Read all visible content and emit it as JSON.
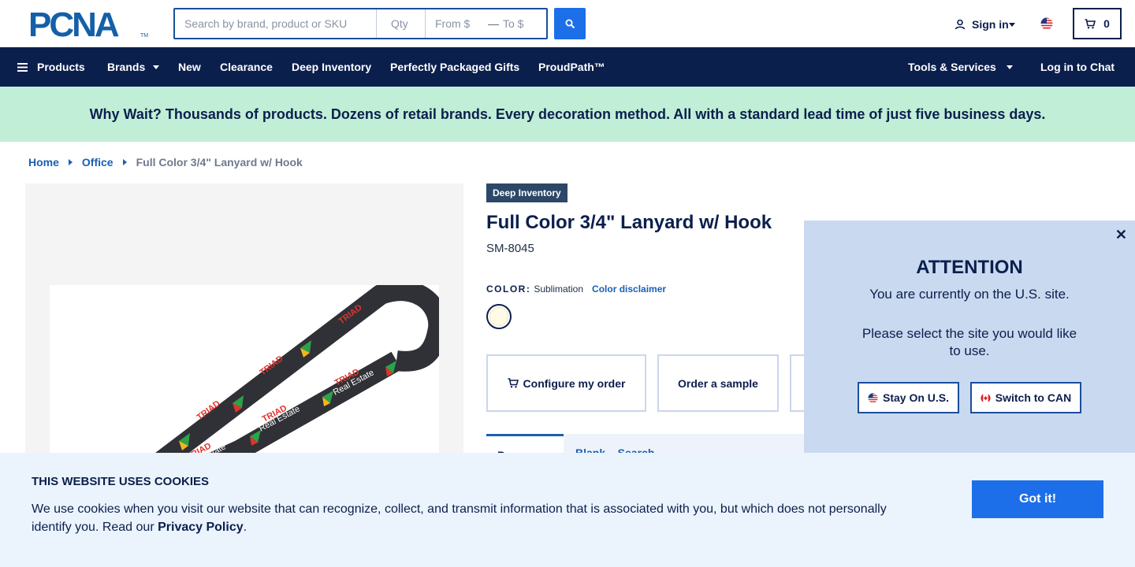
{
  "header": {
    "logo": "PCNA",
    "search_placeholder": "Search by brand, product or SKU",
    "qty_placeholder": "Qty",
    "from_placeholder": "From $",
    "price_dash": "—",
    "to_placeholder": "To $",
    "signin_label": "Sign in",
    "cart_count": "0"
  },
  "nav": {
    "products": "Products",
    "brands": "Brands",
    "new": "New",
    "clearance": "Clearance",
    "deep_inventory": "Deep Inventory",
    "perfectly_packaged": "Perfectly Packaged Gifts",
    "proudpath": "ProudPath™",
    "tools_services": "Tools & Services",
    "chat": "Log in to Chat"
  },
  "banner": {
    "text": "Why Wait? Thousands of products. Dozens of retail brands. Every decoration method. All with a standard lead time of just five business days."
  },
  "breadcrumb": {
    "home": "Home",
    "office": "Office",
    "current": "Full Color 3/4\" Lanyard w/ Hook"
  },
  "product": {
    "badge": "Deep Inventory",
    "title": "Full Color 3/4\" Lanyard w/ Hook",
    "sku": "SM-8045",
    "color_label": "COLOR:",
    "color_value": "Sublimation",
    "color_disclaimer": "Color disclaimer",
    "lanyard_brand": "TRIAD",
    "lanyard_sub": "Real Estate",
    "buttons": {
      "configure": "Configure my order",
      "sample": "Order a sample"
    },
    "tabs": {
      "active": "Pers...",
      "second": "Blank...  Search..."
    }
  },
  "modal": {
    "title": "ATTENTION",
    "line1": "You are currently on the U.S. site.",
    "line2": "Please select the site you would like to use.",
    "stay": "Stay On U.S.",
    "switch": "Switch to CAN"
  },
  "cookie": {
    "title": "THIS WEBSITE USES COOKIES",
    "text": "We use cookies when you visit our website that can recognize, collect, and transmit information that is associated with you, but which does not personally identify you. Read our ",
    "link": "Privacy Policy",
    "end": ".",
    "button": "Got it!"
  },
  "colors": {
    "navy": "#0b1f4d",
    "accent_blue": "#1c6fe8",
    "banner_green": "#c1eed6",
    "modal_bg": "#c9d9ef"
  }
}
